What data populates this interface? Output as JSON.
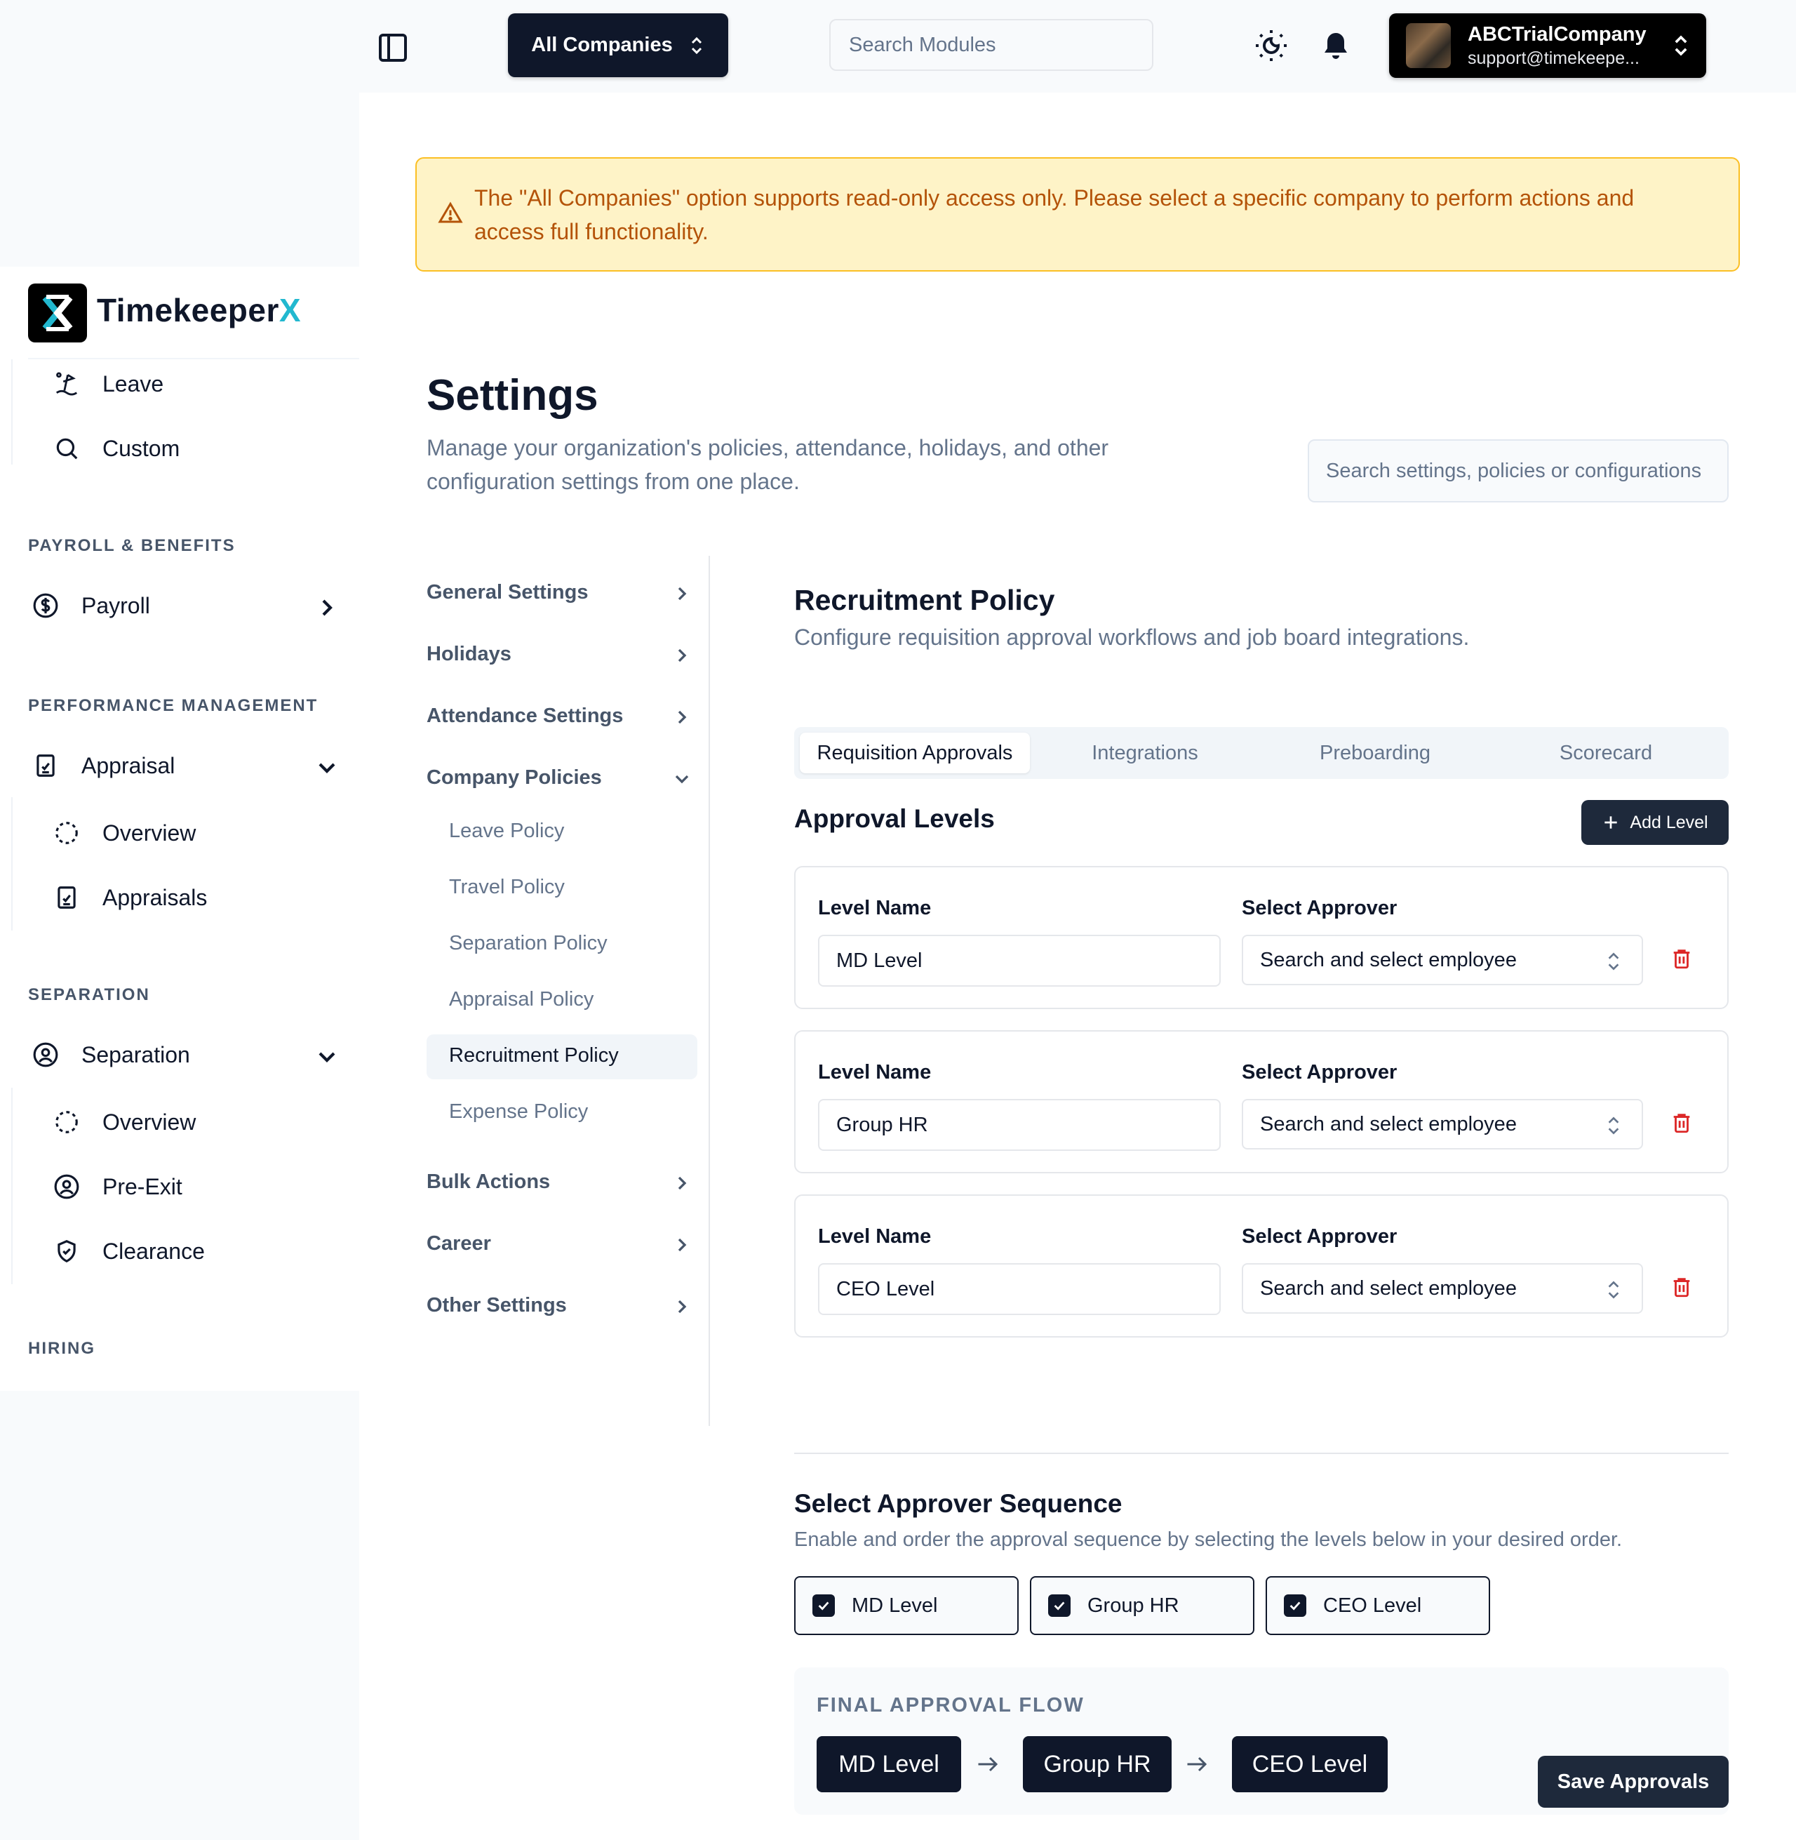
{
  "topbar": {
    "company_select_label": "All Companies",
    "module_search_placeholder": "Search Modules",
    "account_name": "ABCTrialCompany",
    "account_email": "support@timekeepe..."
  },
  "nav": {
    "brand_main": "Timekeeper",
    "brand_accent": "X",
    "items_top": [
      {
        "label": "Leave",
        "icon": "beach-icon"
      },
      {
        "label": "Custom",
        "icon": "search-icon"
      }
    ],
    "sections": [
      {
        "title": "PAYROLL & BENEFITS"
      },
      {
        "title": "PERFORMANCE MANAGEMENT"
      },
      {
        "title": "SEPARATION"
      },
      {
        "title": "HIRING"
      }
    ],
    "payroll": {
      "label": "Payroll",
      "icon": "dollar-circle-icon"
    },
    "appraisal": {
      "label": "Appraisal",
      "icon": "clipboard-icon",
      "children": [
        {
          "label": "Overview",
          "icon": "dashed-circle-icon"
        },
        {
          "label": "Appraisals",
          "icon": "clipboard-check-icon"
        }
      ]
    },
    "separation": {
      "label": "Separation",
      "icon": "user-circle-icon",
      "children": [
        {
          "label": "Overview",
          "icon": "dashed-circle-icon"
        },
        {
          "label": "Pre-Exit",
          "icon": "user-circle-icon"
        },
        {
          "label": "Clearance",
          "icon": "shield-check-icon"
        }
      ]
    }
  },
  "alert": {
    "text": "The \"All Companies\" option supports read-only access only. Please select a specific company to perform actions and access full functionality."
  },
  "page": {
    "title": "Settings",
    "subtitle": "Manage your organization's policies, attendance, holidays, and other configuration settings from one place.",
    "search_placeholder": "Search settings, policies or configurations"
  },
  "settings_menu": {
    "items": [
      {
        "label": "General Settings"
      },
      {
        "label": "Holidays"
      },
      {
        "label": "Attendance Settings"
      },
      {
        "label": "Company Policies"
      },
      {
        "label": "Bulk Actions"
      },
      {
        "label": "Career"
      },
      {
        "label": "Other Settings"
      }
    ],
    "policies": [
      {
        "label": "Leave Policy"
      },
      {
        "label": "Travel Policy"
      },
      {
        "label": "Separation Policy"
      },
      {
        "label": "Appraisal Policy"
      },
      {
        "label": "Recruitment Policy"
      },
      {
        "label": "Expense Policy"
      }
    ],
    "active": "Recruitment Policy"
  },
  "recruitment": {
    "title": "Recruitment Policy",
    "subtitle": "Configure requisition approval workflows and job board integrations.",
    "tabs": [
      {
        "label": "Requisition Approvals",
        "active": true
      },
      {
        "label": "Integrations"
      },
      {
        "label": "Preboarding"
      },
      {
        "label": "Scorecard"
      }
    ],
    "levels_title": "Approval Levels",
    "add_level_label": "Add Level",
    "level_name_label": "Level Name",
    "select_approver_label": "Select Approver",
    "levels": [
      {
        "name": "MD Level",
        "approver_placeholder": "Search and select employee"
      },
      {
        "name": "Group HR",
        "approver_placeholder": "Search and select employee"
      },
      {
        "name": "CEO Level",
        "approver_placeholder": "Search and select employee"
      }
    ],
    "sequence_title": "Select Approver Sequence",
    "sequence_subtitle": "Enable and order the approval sequence by selecting the levels below in your desired order.",
    "sequence": [
      {
        "label": "MD Level",
        "checked": true
      },
      {
        "label": "Group HR",
        "checked": true
      },
      {
        "label": "CEO Level",
        "checked": true
      }
    ],
    "flow_label": "FINAL APPROVAL FLOW",
    "flow": [
      "MD Level",
      "Group HR",
      "CEO Level"
    ],
    "save_label": "Save Approvals"
  },
  "colors": {
    "primary": "#0f172a",
    "accent": "#22b8cf",
    "warning_bg": "#fef3c7",
    "warning_text": "#b45309",
    "danger": "#dc2626"
  }
}
